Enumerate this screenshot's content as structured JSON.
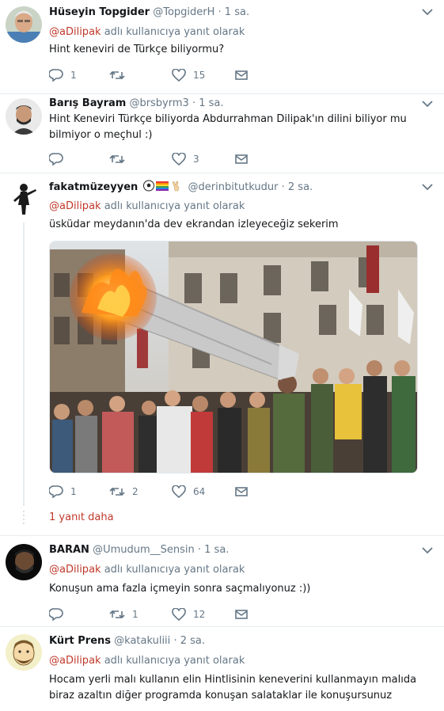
{
  "reply_prefix": "adlı kullanıcıya yanıt olarak",
  "mention": "@aDilipak",
  "tweets": [
    {
      "name": "Hüseyin Topgider",
      "handle": "@TopgiderH",
      "time": "· 1 sa.",
      "text": "Hint keneviri de Türkçe biliyormu?",
      "reply_count": "1",
      "retweet_count": "",
      "like_count": "15"
    },
    {
      "name": "Barış Bayram",
      "handle": "@brsbyrm3",
      "time": "· 1 sa.",
      "text": "Hint Keneviri Türkçe biliyorda Abdurrahman Dilipak'ın dilini biliyor mu bilmiyor o meçhul :)",
      "reply_count": "",
      "retweet_count": "",
      "like_count": "3"
    },
    {
      "name": "fakatmüzeyyen",
      "handle": "@derinbitutkudur",
      "time": "· 2 sa.",
      "text": "üsküdar meydanın'da dev ekrandan izleyeceğiz sekerim",
      "reply_count": "1",
      "retweet_count": "2",
      "like_count": "64",
      "media_label": "protest-photo"
    },
    {
      "name": "BARAN",
      "handle": "@Umudum__Sensin",
      "time": "· 1 sa.",
      "text": "Konuşun ama fazla içmeyin sonra saçmalıyonuz :))",
      "reply_count": "",
      "retweet_count": "1",
      "like_count": "12"
    },
    {
      "name": "Kürt Prens",
      "handle": "@katakuliii",
      "time": "· 2 sa.",
      "text": "Hocam yerli malı kullanın elin Hintlisinin keneverini kullanmayın malıda biraz azaltın diğer programda konuşan salataklar ile konuşursunuz"
    }
  ],
  "show_more": "1 yanıt daha",
  "colors": {
    "mention": "#c0392b",
    "muted": "#657786",
    "border": "#e6ecf0"
  },
  "icons": [
    "reply-icon",
    "retweet-icon",
    "like-icon",
    "message-icon",
    "chevron-down-icon"
  ]
}
